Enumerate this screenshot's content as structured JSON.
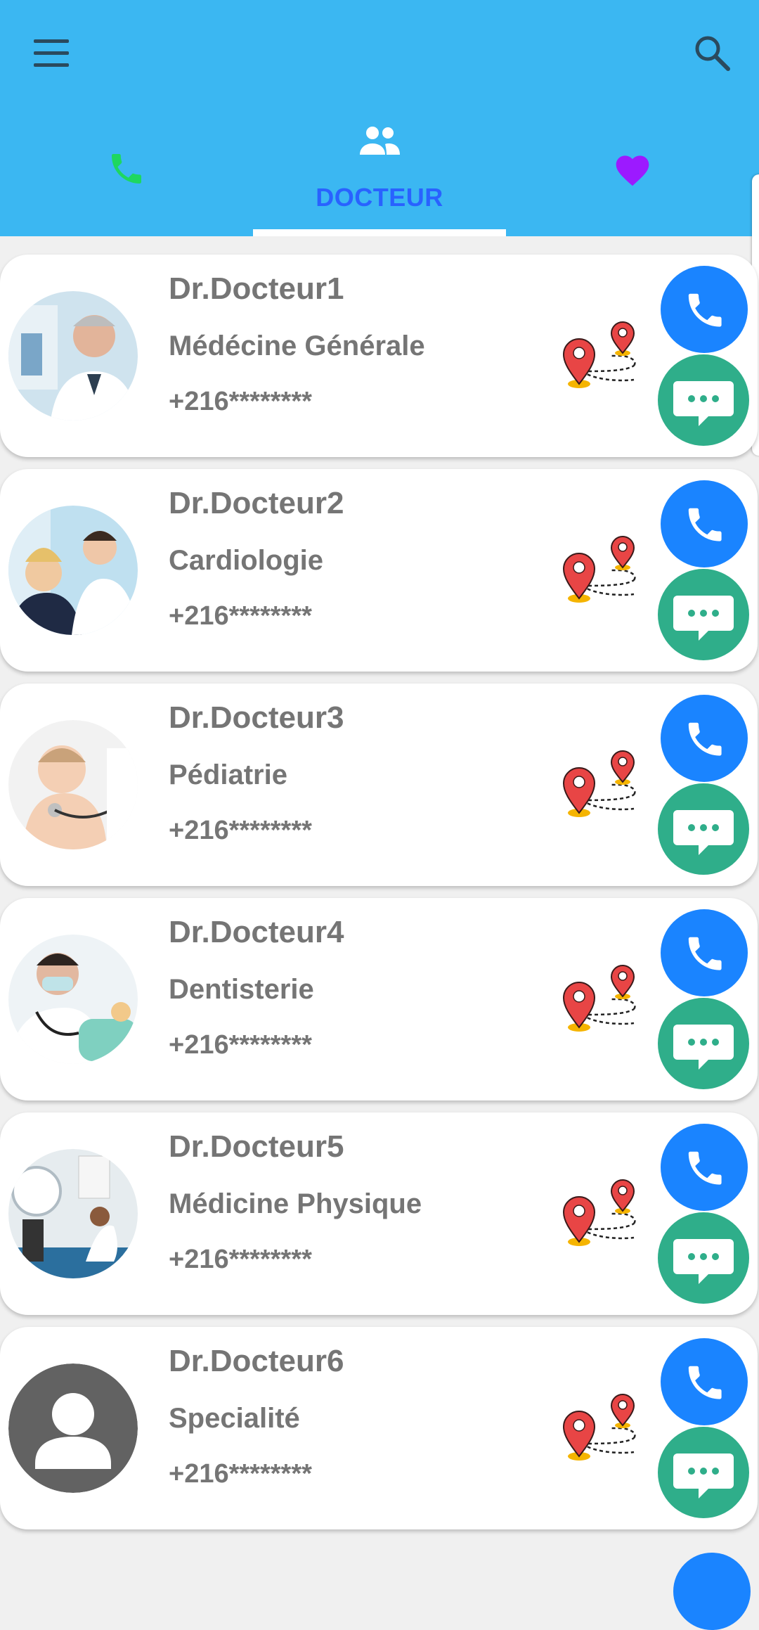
{
  "toolbar": {
    "menu_icon": "menu-icon",
    "search_icon": "search-icon"
  },
  "tabs": [
    {
      "icon": "phone-icon",
      "label": "",
      "color": "#1ed760"
    },
    {
      "icon": "group-icon",
      "label": "DOCTEUR",
      "color": "#ffffff",
      "selected": true
    },
    {
      "icon": "heart-icon",
      "label": "",
      "color": "#9c1aff"
    }
  ],
  "doctors": [
    {
      "name": "Dr.Docteur1",
      "specialty": "Médécine Générale",
      "phone": "+216********",
      "avatar": "doctor-photo"
    },
    {
      "name": "Dr.Docteur2",
      "specialty": "Cardiologie",
      "phone": "+216********",
      "avatar": "doctor-photo"
    },
    {
      "name": "Dr.Docteur3",
      "specialty": "Pédiatrie",
      "phone": "+216********",
      "avatar": "doctor-photo"
    },
    {
      "name": "Dr.Docteur4",
      "specialty": "Dentisterie",
      "phone": "+216********",
      "avatar": "doctor-photo"
    },
    {
      "name": "Dr.Docteur5",
      "specialty": "Médicine Physique",
      "phone": "+216********",
      "avatar": "doctor-photo"
    },
    {
      "name": "Dr.Docteur6",
      "specialty": "Specialité",
      "phone": "+216********",
      "avatar": "default-person"
    }
  ],
  "colors": {
    "appbar": "#3bb7f2",
    "selected_tab_text": "#2962ff",
    "call_button": "#1a84ff",
    "message_button": "#2fae8a",
    "text": "#757575"
  }
}
